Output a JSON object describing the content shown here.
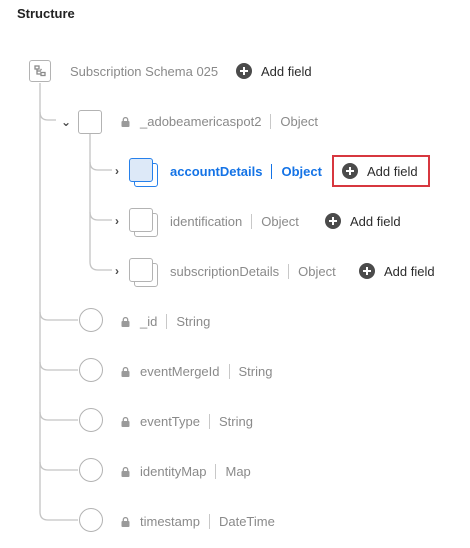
{
  "heading": "Structure",
  "root": {
    "name": "Subscription Schema 025",
    "add_field_label": "Add field",
    "icon": "schema-icon"
  },
  "object_node": {
    "name": "_adobeamericaspot2",
    "type": "Object",
    "locked": true,
    "expanded": true
  },
  "children": [
    {
      "name": "accountDetails",
      "type": "Object",
      "selected": true,
      "add_field_label": "Add field"
    },
    {
      "name": "identification",
      "type": "Object",
      "selected": false,
      "add_field_label": "Add field"
    },
    {
      "name": "subscriptionDetails",
      "type": "Object",
      "selected": false,
      "add_field_label": "Add field"
    }
  ],
  "fields": [
    {
      "name": "_id",
      "type": "String",
      "locked": true
    },
    {
      "name": "eventMergeId",
      "type": "String",
      "locked": true
    },
    {
      "name": "eventType",
      "type": "String",
      "locked": true
    },
    {
      "name": "identityMap",
      "type": "Map",
      "locked": true
    },
    {
      "name": "timestamp",
      "type": "DateTime",
      "locked": true
    }
  ],
  "colors": {
    "selected": "#1473e6",
    "highlight_border": "#d7373f",
    "connector": "#c4c4c4"
  }
}
